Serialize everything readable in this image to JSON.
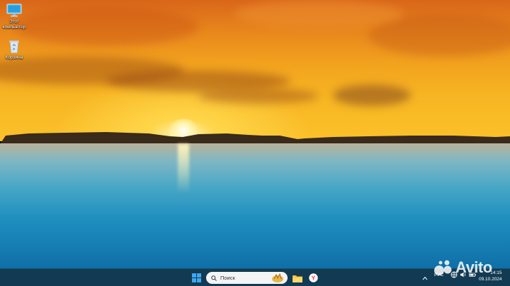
{
  "desktop": {
    "icons": [
      {
        "label": "Этот компьютер",
        "icon": "monitor-icon"
      },
      {
        "label": "Корзина",
        "icon": "recycle-bin-icon"
      }
    ]
  },
  "taskbar": {
    "start_icon": "windows-start-icon",
    "search": {
      "placeholder": "Поиск",
      "icon": "search-icon"
    },
    "pinned": [
      {
        "name": "File Explorer",
        "icon": "folder-icon"
      },
      {
        "name": "Yandex Browser",
        "icon": "yandex-browser-icon",
        "glyph": "Y"
      }
    ],
    "tray": {
      "chevron_icon": "chevron-up-icon",
      "language": "РУС",
      "icons": [
        "network-icon",
        "volume-icon",
        "battery-icon"
      ]
    },
    "clock": {
      "time": "14:15",
      "date": "09.10.2024"
    }
  },
  "watermark": {
    "text": "Avito"
  },
  "colors": {
    "taskbar": "#123a52",
    "sky_top": "#d9661a",
    "sky_horizon": "#fbc12a",
    "sea": "#1f8fc0"
  }
}
